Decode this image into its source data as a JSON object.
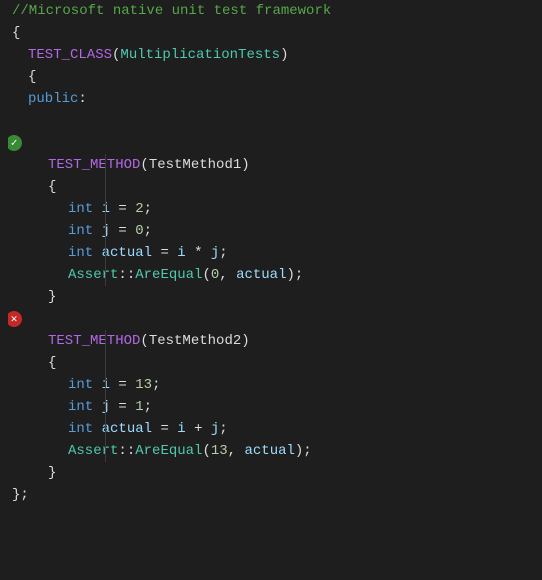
{
  "editor": {
    "background": "#1e1e1e",
    "lines": [
      {
        "id": 1,
        "type": "comment",
        "indent": 0,
        "content": "//Microsoft native unit test framework"
      },
      {
        "id": 2,
        "type": "plain",
        "indent": 0,
        "content": "{"
      },
      {
        "id": 3,
        "type": "code",
        "indent": 1,
        "parts": [
          {
            "type": "macro",
            "text": "TEST_CLASS"
          },
          {
            "type": "plain",
            "text": "("
          },
          {
            "type": "class-name",
            "text": "MultiplicationTests"
          },
          {
            "type": "plain",
            "text": ")"
          }
        ]
      },
      {
        "id": 4,
        "type": "plain",
        "indent": 1,
        "content": "{"
      },
      {
        "id": 5,
        "type": "code",
        "indent": 1,
        "parts": [
          {
            "type": "keyword",
            "text": "public"
          },
          {
            "type": "plain",
            "text": ":"
          }
        ]
      },
      {
        "id": 6,
        "type": "empty"
      },
      {
        "id": 7,
        "type": "icon-pass",
        "indent": 2,
        "content": ""
      },
      {
        "id": 8,
        "type": "code",
        "indent": 2,
        "parts": [
          {
            "type": "macro",
            "text": "TEST_METHOD"
          },
          {
            "type": "plain",
            "text": "("
          },
          {
            "type": "method-name",
            "text": "TestMethod1"
          },
          {
            "type": "plain",
            "text": ")"
          }
        ]
      },
      {
        "id": 9,
        "type": "plain",
        "indent": 2,
        "content": "{"
      },
      {
        "id": 10,
        "type": "code",
        "indent": 3,
        "parts": [
          {
            "type": "keyword",
            "text": "int"
          },
          {
            "type": "plain",
            "text": " "
          },
          {
            "type": "variable",
            "text": "i"
          },
          {
            "type": "plain",
            "text": " = "
          },
          {
            "type": "number",
            "text": "2"
          },
          {
            "type": "plain",
            "text": ";"
          }
        ]
      },
      {
        "id": 11,
        "type": "code",
        "indent": 3,
        "parts": [
          {
            "type": "keyword",
            "text": "int"
          },
          {
            "type": "plain",
            "text": " "
          },
          {
            "type": "variable",
            "text": "j"
          },
          {
            "type": "plain",
            "text": " = "
          },
          {
            "type": "number",
            "text": "0"
          },
          {
            "type": "plain",
            "text": ";"
          }
        ]
      },
      {
        "id": 12,
        "type": "code",
        "indent": 3,
        "parts": [
          {
            "type": "keyword",
            "text": "int"
          },
          {
            "type": "plain",
            "text": " "
          },
          {
            "type": "variable",
            "text": "actual"
          },
          {
            "type": "plain",
            "text": " = "
          },
          {
            "type": "variable",
            "text": "i"
          },
          {
            "type": "plain",
            "text": " * "
          },
          {
            "type": "variable",
            "text": "j"
          },
          {
            "type": "plain",
            "text": ";"
          }
        ]
      },
      {
        "id": 13,
        "type": "code",
        "indent": 3,
        "parts": [
          {
            "type": "assert",
            "text": "Assert"
          },
          {
            "type": "plain",
            "text": "::"
          },
          {
            "type": "assert",
            "text": "AreEqual"
          },
          {
            "type": "plain",
            "text": "("
          },
          {
            "type": "number",
            "text": "0"
          },
          {
            "type": "plain",
            "text": ", "
          },
          {
            "type": "variable",
            "text": "actual"
          },
          {
            "type": "plain",
            "text": ");"
          }
        ]
      },
      {
        "id": 14,
        "type": "plain",
        "indent": 2,
        "content": "}"
      },
      {
        "id": 15,
        "type": "icon-fail",
        "indent": 2,
        "content": ""
      },
      {
        "id": 16,
        "type": "code",
        "indent": 2,
        "parts": [
          {
            "type": "macro",
            "text": "TEST_METHOD"
          },
          {
            "type": "plain",
            "text": "("
          },
          {
            "type": "method-name",
            "text": "TestMethod2"
          },
          {
            "type": "plain",
            "text": ")"
          }
        ]
      },
      {
        "id": 17,
        "type": "plain",
        "indent": 2,
        "content": "{"
      },
      {
        "id": 18,
        "type": "code",
        "indent": 3,
        "parts": [
          {
            "type": "keyword",
            "text": "int"
          },
          {
            "type": "plain",
            "text": " "
          },
          {
            "type": "variable",
            "text": "i"
          },
          {
            "type": "plain",
            "text": " = "
          },
          {
            "type": "number",
            "text": "13"
          },
          {
            "type": "plain",
            "text": ";"
          }
        ]
      },
      {
        "id": 19,
        "type": "code",
        "indent": 3,
        "parts": [
          {
            "type": "keyword",
            "text": "int"
          },
          {
            "type": "plain",
            "text": " "
          },
          {
            "type": "variable",
            "text": "j"
          },
          {
            "type": "plain",
            "text": " = "
          },
          {
            "type": "number",
            "text": "1"
          },
          {
            "type": "plain",
            "text": ";"
          }
        ]
      },
      {
        "id": 20,
        "type": "code",
        "indent": 3,
        "parts": [
          {
            "type": "keyword",
            "text": "int"
          },
          {
            "type": "plain",
            "text": " "
          },
          {
            "type": "variable",
            "text": "actual"
          },
          {
            "type": "plain",
            "text": " = "
          },
          {
            "type": "variable",
            "text": "i"
          },
          {
            "type": "plain",
            "text": " + "
          },
          {
            "type": "variable",
            "text": "j"
          },
          {
            "type": "plain",
            "text": ";"
          }
        ]
      },
      {
        "id": 21,
        "type": "code",
        "indent": 3,
        "parts": [
          {
            "type": "assert",
            "text": "Assert"
          },
          {
            "type": "plain",
            "text": "::"
          },
          {
            "type": "assert",
            "text": "AreEqual"
          },
          {
            "type": "plain",
            "text": "("
          },
          {
            "type": "number",
            "text": "13"
          },
          {
            "type": "plain",
            "text": ", "
          },
          {
            "type": "variable",
            "text": "actual"
          },
          {
            "type": "plain",
            "text": ");"
          }
        ]
      },
      {
        "id": 22,
        "type": "plain",
        "indent": 2,
        "content": "}"
      },
      {
        "id": 23,
        "type": "plain",
        "indent": 0,
        "content": "};"
      }
    ],
    "icons": {
      "pass": "✓",
      "fail": "✕"
    }
  }
}
